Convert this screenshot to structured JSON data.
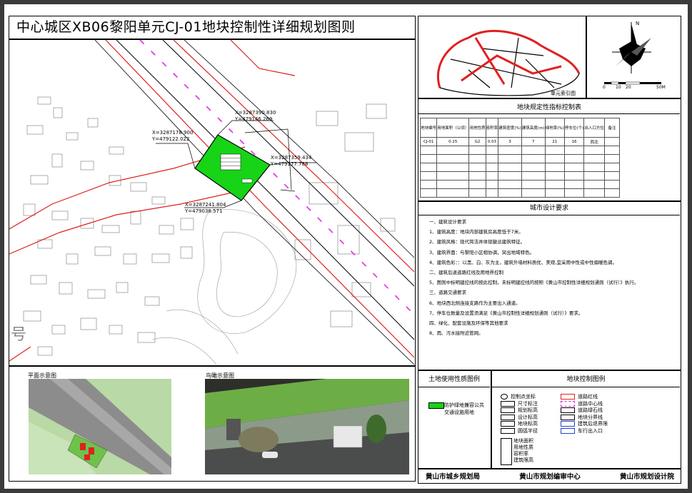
{
  "title": "中心城区XB06黎阳单元CJ-01地块控制性详细规划图则",
  "map": {
    "coords": [
      {
        "x": "X=3287390.830",
        "y": "Y=479146.269"
      },
      {
        "x": "X=3287178.900",
        "y": "Y=479122.022"
      },
      {
        "x": "X=3287359.434",
        "y": "Y=479177.788"
      },
      {
        "x": "X=3287241.804",
        "y": "Y=479038.571"
      }
    ],
    "side_char": "号"
  },
  "index_map": {
    "caption": "单元索引图"
  },
  "north": {
    "letter": "N",
    "scale_labels": [
      "0",
      "10",
      "20",
      "50M"
    ]
  },
  "indicator_table": {
    "title": "地块规定性指标控制表",
    "headers": [
      "地块编号",
      "用地面积（公顷）",
      "用地性质",
      "容积率",
      "建筑密度(%)",
      "建筑高度(m)",
      "绿地率(%)",
      "停车位(个)",
      "出入口方位",
      "备注"
    ],
    "row": [
      "CJ-01",
      "0.15",
      "G2",
      "0.03",
      "3",
      "7",
      "21",
      "16",
      "西北",
      ""
    ]
  },
  "design": {
    "title": "城市设计要求",
    "items": [
      "一、建筑设计要求",
      "1、建筑高度：地块内部建筑房高度低于7米。",
      "2、建筑风格：现代简洁并体现徽派建筑特征。",
      "3、建筑界面：与黎阳小区相协调，突出地域特色。",
      "4、建筑色彩：：以黑、白、灰为主，建筑外墙材料质优、美观,宜采用中性或中性偏暖色调。",
      "二、建筑后退道路红线及用地界控制",
      "5、图则中标明建控线的按此控制，未标明建控线的按照《黄山市控制性详细规划通则（试行）》执行。",
      "三、道路交通要求",
      "6、地块西北侧连接支路作为主要出入通道。",
      "7、停车位数量及设置须满足《黄山市控制性详细规划通则（试行）》要求。",
      "四、绿化、配套设施及环保等其他要求",
      "8、雨、污水接附近管网。"
    ]
  },
  "land_use_legend": {
    "title": "土地使用性质图例",
    "items": [
      {
        "label": "防护绿地兼容公共交通设施用地",
        "color": "#17d417"
      }
    ]
  },
  "control_legend": {
    "title": "地块控制图例",
    "left": [
      "控制点坐标",
      "尺寸标注",
      "规划标高",
      "设计标高",
      "地块标高",
      "圆弧半径"
    ],
    "right": [
      "道路红线",
      "道路中心线",
      "道路绿石线",
      "地块分界线",
      "建筑后退界限",
      "车行出入口"
    ],
    "box": [
      "地块面积",
      "用地性质",
      "容积率",
      "建筑限高"
    ]
  },
  "plan_view": {
    "caption": "平面示意图"
  },
  "aerial_view": {
    "caption": "鸟瞰示意图"
  },
  "footer": [
    "黄山市城乡规划局",
    "黄山市规划编审中心",
    "黄山市规划设计院"
  ],
  "colors": {
    "plot_green": "#17d417",
    "red_line": "#e02020",
    "magenta": "#e020e0"
  }
}
